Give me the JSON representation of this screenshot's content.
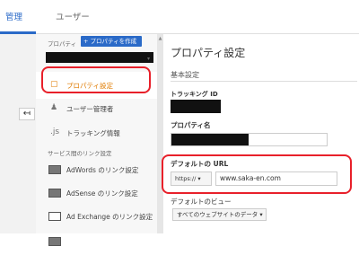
{
  "tabs": {
    "admin": "管理",
    "user": "ユーザー"
  },
  "nav": {
    "property_label": "プロパティ",
    "create_button": "+ プロパティを作成",
    "items": {
      "settings": "プロパティ設定",
      "users": "ユーザー管理者",
      "tracking": "トラッキング情報",
      "tracking_icon": ".js",
      "section_links": "サービス間のリンク設定",
      "adwords": "AdWords のリンク設定",
      "adsense": "AdSense のリンク設定",
      "adexchange": "Ad Exchange のリンク設定"
    }
  },
  "main": {
    "title": "プロパティ設定",
    "basic_section": "基本設定",
    "tracking_id_label": "トラッキング ID",
    "property_name_label": "プロパティ名",
    "default_url_label": "デフォルトの URL",
    "protocol": "https:// ▾",
    "url_value": "www.saka-en.com",
    "default_view_label": "デフォルトのビュー",
    "default_view_value": "すべてのウェブサイトのデータ ▾"
  },
  "colors": {
    "accent": "#2a6ac8",
    "active": "#e07b00",
    "highlight": "#e8202a"
  }
}
